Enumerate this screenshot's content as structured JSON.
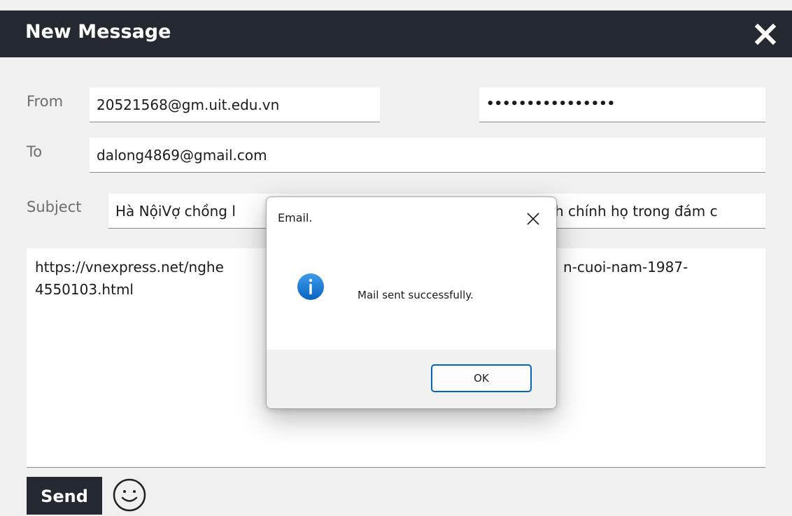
{
  "window": {
    "title": "New Message"
  },
  "form": {
    "from_label": "From",
    "from_value": "20521568@gm.uit.edu.vn",
    "password_value": "••••••••••••••••",
    "to_label": "To",
    "to_value": "dalong4869@gmail.com",
    "subject_label": "Subject",
    "subject_value_left": "Hà NộiVợ chồng l",
    "subject_value_right": "h chính họ trong đám c",
    "body_line1_left": "https://vnexpress.net/nghe",
    "body_line1_right": "n-cuoi-nam-1987-",
    "body_line2": "4550103.html"
  },
  "toolbar": {
    "send_label": "Send",
    "emoji_icon": "smiley-icon"
  },
  "dialog": {
    "title": "Email.",
    "message": "Mail sent successfully.",
    "ok_label": "OK",
    "icon": "info-icon",
    "accent_color": "#0067c0"
  },
  "colors": {
    "header": "#242931",
    "background": "#f0f0f0"
  }
}
